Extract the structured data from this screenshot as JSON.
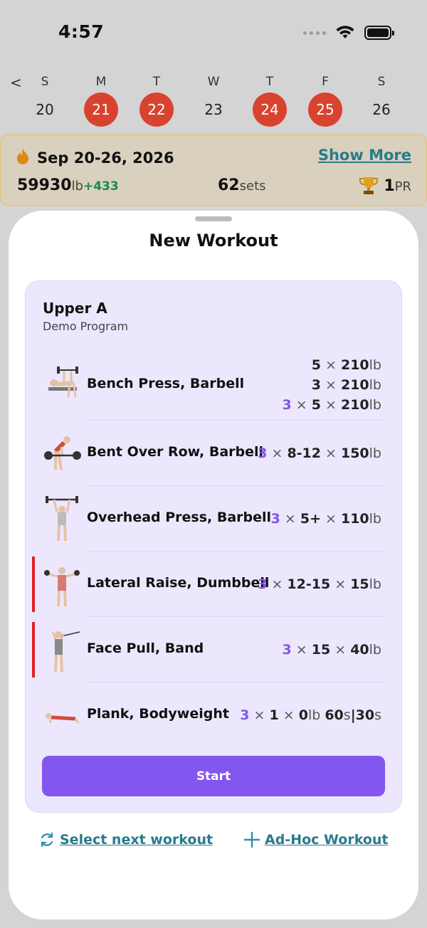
{
  "status": {
    "time": "4:57"
  },
  "week": {
    "prev_icon": "chevron-left-icon",
    "days": [
      {
        "letter": "S",
        "num": "20",
        "active": false
      },
      {
        "letter": "M",
        "num": "21",
        "active": true
      },
      {
        "letter": "T",
        "num": "22",
        "active": true
      },
      {
        "letter": "W",
        "num": "23",
        "active": false
      },
      {
        "letter": "T",
        "num": "24",
        "active": true
      },
      {
        "letter": "F",
        "num": "25",
        "active": true
      },
      {
        "letter": "S",
        "num": "26",
        "active": false
      }
    ]
  },
  "summary": {
    "range": "Sep 20-26, 2026",
    "show_more": "Show More",
    "volume": "59930",
    "volume_unit": "lb",
    "volume_delta": "+433",
    "sets": "62",
    "sets_unit": "sets",
    "pr_count": "1",
    "pr_unit": "PR"
  },
  "sheet": {
    "title": "New Workout",
    "program": {
      "name": "Upper A",
      "subtitle": "Demo Program"
    },
    "exercises": [
      {
        "name": "Bench Press, Barbell",
        "flag": false,
        "lines": [
          {
            "count": "",
            "reps": "5",
            "weight": "210",
            "unit": "lb"
          },
          {
            "count": "",
            "reps": "3",
            "weight": "210",
            "unit": "lb"
          },
          {
            "count": "3",
            "reps": "5",
            "weight": "210",
            "unit": "lb"
          }
        ]
      },
      {
        "name": "Bent Over Row, Barbell",
        "flag": false,
        "lines": [
          {
            "count": "3",
            "reps": "8-12",
            "weight": "150",
            "unit": "lb"
          }
        ]
      },
      {
        "name": "Overhead Press, Barbell",
        "flag": false,
        "lines": [
          {
            "count": "3",
            "reps": "5+",
            "weight": "110",
            "unit": "lb"
          }
        ]
      },
      {
        "name": "Lateral Raise, Dumbbell",
        "flag": true,
        "lines": [
          {
            "count": "3",
            "reps": "12-15",
            "weight": "15",
            "unit": "lb"
          }
        ]
      },
      {
        "name": "Face Pull, Band",
        "flag": true,
        "lines": [
          {
            "count": "3",
            "reps": "15",
            "weight": "40",
            "unit": "lb"
          }
        ]
      },
      {
        "name": "Plank, Bodyweight",
        "flag": false,
        "lines": [
          {
            "count": "3",
            "reps": "1",
            "weight": "0",
            "unit": "lb",
            "extra_a": "60",
            "extra_a_unit": "s",
            "sep": "|",
            "extra_b": "30",
            "extra_b_unit": "s"
          }
        ]
      }
    ],
    "start_label": "Start",
    "select_next_label": "Select next workout",
    "adhoc_label": "Ad-Hoc Workout"
  },
  "colors": {
    "accent_purple": "#8356f0",
    "active_day": "#d8432f",
    "link_teal": "#2a7a8c",
    "delta_green": "#1a8a4a",
    "flag_red": "#e3202a"
  }
}
